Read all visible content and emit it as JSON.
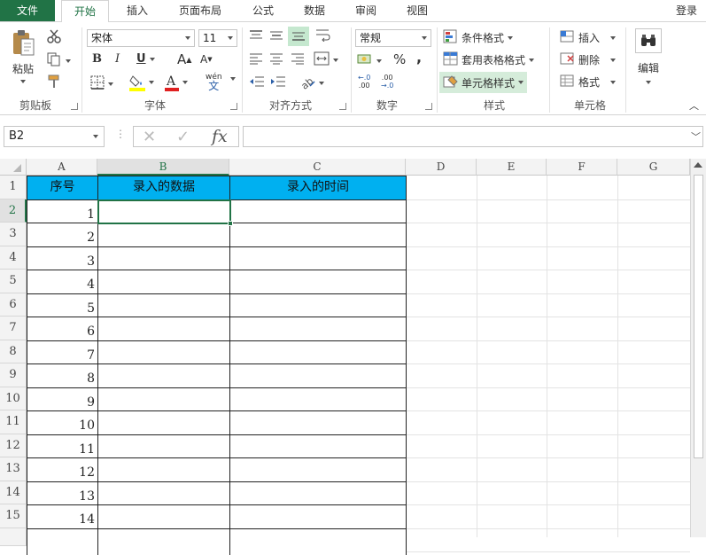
{
  "tabs": [
    "文件",
    "开始",
    "插入",
    "页面布局",
    "公式",
    "数据",
    "审阅",
    "视图"
  ],
  "login_label": "登录",
  "clipboard": {
    "paste_label": "粘贴",
    "group_label": "剪贴板"
  },
  "font": {
    "name": "宋体",
    "size": "11",
    "bold": "B",
    "italic": "I",
    "underline": "U",
    "grow": "A",
    "shrink": "A",
    "phonetic": "wén",
    "group_label": "字体",
    "font_color": "#e02020",
    "fill_color": "#ffff00"
  },
  "alignment": {
    "group_label": "对齐方式"
  },
  "number": {
    "format": "常规",
    "percent": "%",
    "comma": ",",
    "inc_decimal_top": "←.0",
    "inc_decimal_bottom": ".00",
    "dec_decimal_top": ".00",
    "dec_decimal_bottom": "→.0",
    "group_label": "数字"
  },
  "styles": {
    "conditional": "条件格式",
    "table_format": "套用表格格式",
    "cell_styles": "单元格样式",
    "group_label": "样式"
  },
  "cells": {
    "insert": "插入",
    "delete": "删除",
    "format": "格式",
    "group_label": "单元格"
  },
  "editing": {
    "label": "编辑"
  },
  "formula_bar": {
    "name_box": "B2",
    "cancel": "✕",
    "enter": "✓",
    "fx": "fx"
  },
  "grid": {
    "columns": [
      "A",
      "B",
      "C",
      "D",
      "E",
      "F",
      "G"
    ],
    "selected_column": "B",
    "selected_row": "2",
    "row_numbers": [
      "1",
      "2",
      "3",
      "4",
      "5",
      "6",
      "7",
      "8",
      "9",
      "10",
      "11",
      "12",
      "13",
      "14",
      "15"
    ],
    "header_row": [
      "序号",
      "录入的数据",
      "录入的时间"
    ],
    "header_fill": "#00b0f0",
    "serial_values": [
      "1",
      "2",
      "3",
      "4",
      "5",
      "6",
      "7",
      "8",
      "9",
      "10",
      "11",
      "12",
      "13",
      "14"
    ],
    "accent": "#217346"
  }
}
